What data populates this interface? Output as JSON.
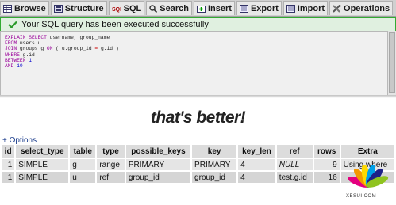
{
  "tabs": [
    {
      "label": "Browse",
      "icon": "browse-icon"
    },
    {
      "label": "Structure",
      "icon": "structure-icon"
    },
    {
      "label": "SQL",
      "icon": "sql-icon"
    },
    {
      "label": "Search",
      "icon": "search-icon"
    },
    {
      "label": "Insert",
      "icon": "insert-icon"
    },
    {
      "label": "Export",
      "icon": "export-icon"
    },
    {
      "label": "Import",
      "icon": "import-icon"
    },
    {
      "label": "Operations",
      "icon": "operations-icon"
    }
  ],
  "message": {
    "text": "Your SQL query has been executed successfully",
    "icon": "check-icon"
  },
  "sql": {
    "line1_kw1": "EXPLAIN SELECT",
    "line1_rest": " username, group_name",
    "line2_kw": "FROM",
    "line2_rest": " users u",
    "line3_kw1": "JOIN",
    "line3_mid": " groups g ",
    "line3_kw2": "ON",
    "line3_rest": " ( u.group_id ",
    "line3_op": "=",
    "line3_end": " g.id )",
    "line4_kw": "WHERE",
    "line4_rest": " g.id",
    "line5_kw": "BETWEEN",
    "line5_num": " 1",
    "line6_kw": "AND",
    "line6_num": " 10"
  },
  "caption": "that's better!",
  "options_link": "+ Options",
  "table": {
    "headers": [
      "id",
      "select_type",
      "table",
      "type",
      "possible_keys",
      "key",
      "key_len",
      "ref",
      "rows",
      "Extra"
    ],
    "rows": [
      [
        "1",
        "SIMPLE",
        "g",
        "range",
        "PRIMARY",
        "PRIMARY",
        "4",
        "NULL",
        "9",
        "Using where"
      ],
      [
        "1",
        "SIMPLE",
        "u",
        "ref",
        "group_id",
        "group_id",
        "4",
        "test.g.id",
        "16",
        ""
      ]
    ]
  },
  "watermark": "XBSUI.COM",
  "colors": {
    "success_border": "#33aa33",
    "success_bg": "#e0f0e0",
    "keyword": "#990099"
  }
}
